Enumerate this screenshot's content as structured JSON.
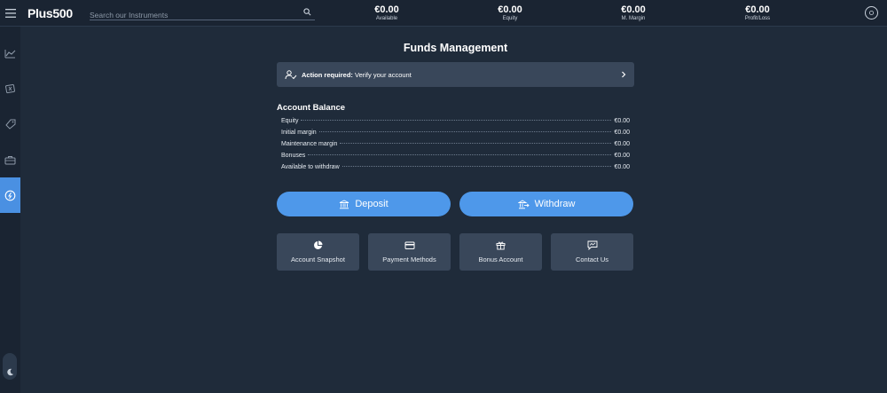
{
  "header": {
    "logo": "Plus500",
    "search_placeholder": "Search our Instruments",
    "stats": [
      {
        "value": "€0.00",
        "label": "Available"
      },
      {
        "value": "€0.00",
        "label": "Equity"
      },
      {
        "value": "€0.00",
        "label": "M. Margin"
      },
      {
        "value": "€0.00",
        "label": "Profit/Loss"
      }
    ]
  },
  "sidebar": {
    "items": [
      "chart-icon",
      "trade-swap-icon",
      "tag-icon",
      "briefcase-icon",
      "funds-icon"
    ],
    "active": "funds-icon"
  },
  "main": {
    "title": "Funds Management",
    "banner": {
      "bold": "Action required:",
      "text": " Verify your account"
    },
    "section_title": "Account Balance",
    "balances": [
      {
        "label": "Equity",
        "value": "€0.00"
      },
      {
        "label": "Initial margin",
        "value": "€0.00"
      },
      {
        "label": "Maintenance margin",
        "value": "€0.00"
      },
      {
        "label": "Bonuses",
        "value": "€0.00"
      },
      {
        "label": "Available to withdraw",
        "value": "€0.00"
      }
    ],
    "deposit_label": "Deposit",
    "withdraw_label": "Withdraw",
    "tiles": [
      {
        "label": "Account Snapshot",
        "icon": "pie-chart-icon"
      },
      {
        "label": "Payment Methods",
        "icon": "credit-card-icon"
      },
      {
        "label": "Bonus Account",
        "icon": "gift-icon"
      },
      {
        "label": "Contact Us",
        "icon": "chat-icon"
      }
    ]
  },
  "colors": {
    "accent": "#4e98ea",
    "background": "#1f2b3a",
    "panel": "#39475a"
  }
}
